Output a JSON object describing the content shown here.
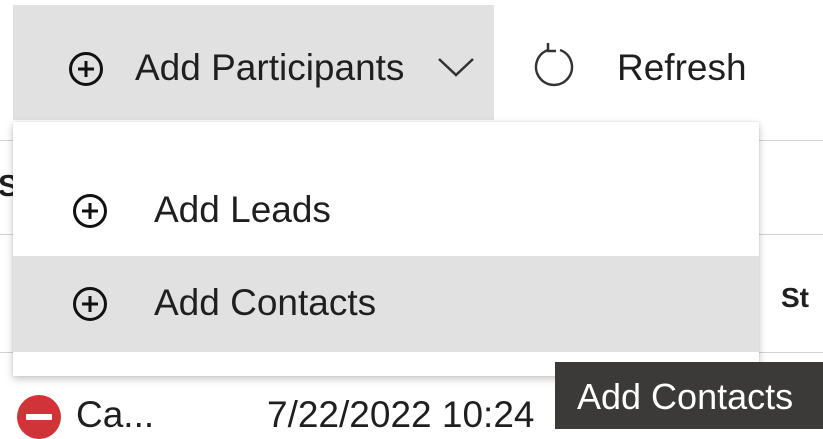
{
  "toolbar": {
    "add_participants": {
      "label": "Add Participants",
      "icon": "plus-circle-icon",
      "dropdown_icon": "chevron-down-icon"
    },
    "refresh": {
      "label": "Refresh",
      "icon": "refresh-icon"
    }
  },
  "dropdown": {
    "items": [
      {
        "label": "Add Leads",
        "icon": "plus-circle-icon",
        "highlighted": false
      },
      {
        "label": "Add Contacts",
        "icon": "plus-circle-icon",
        "highlighted": true
      }
    ]
  },
  "grid": {
    "header_left_partial": "St",
    "header_right_partial": "St",
    "row": {
      "status_icon": "blocked-status-icon",
      "status_color": "#d13438",
      "name": "Ca...",
      "date": "7/22/2022 10:24"
    }
  },
  "tooltip": {
    "text": "Add Contacts"
  },
  "colors": {
    "toolbar_active_bg": "#e1e1e1",
    "menu_highlight_bg": "#e1e1e1",
    "tooltip_bg": "#3b3a39",
    "text": "#1f1f1f"
  }
}
